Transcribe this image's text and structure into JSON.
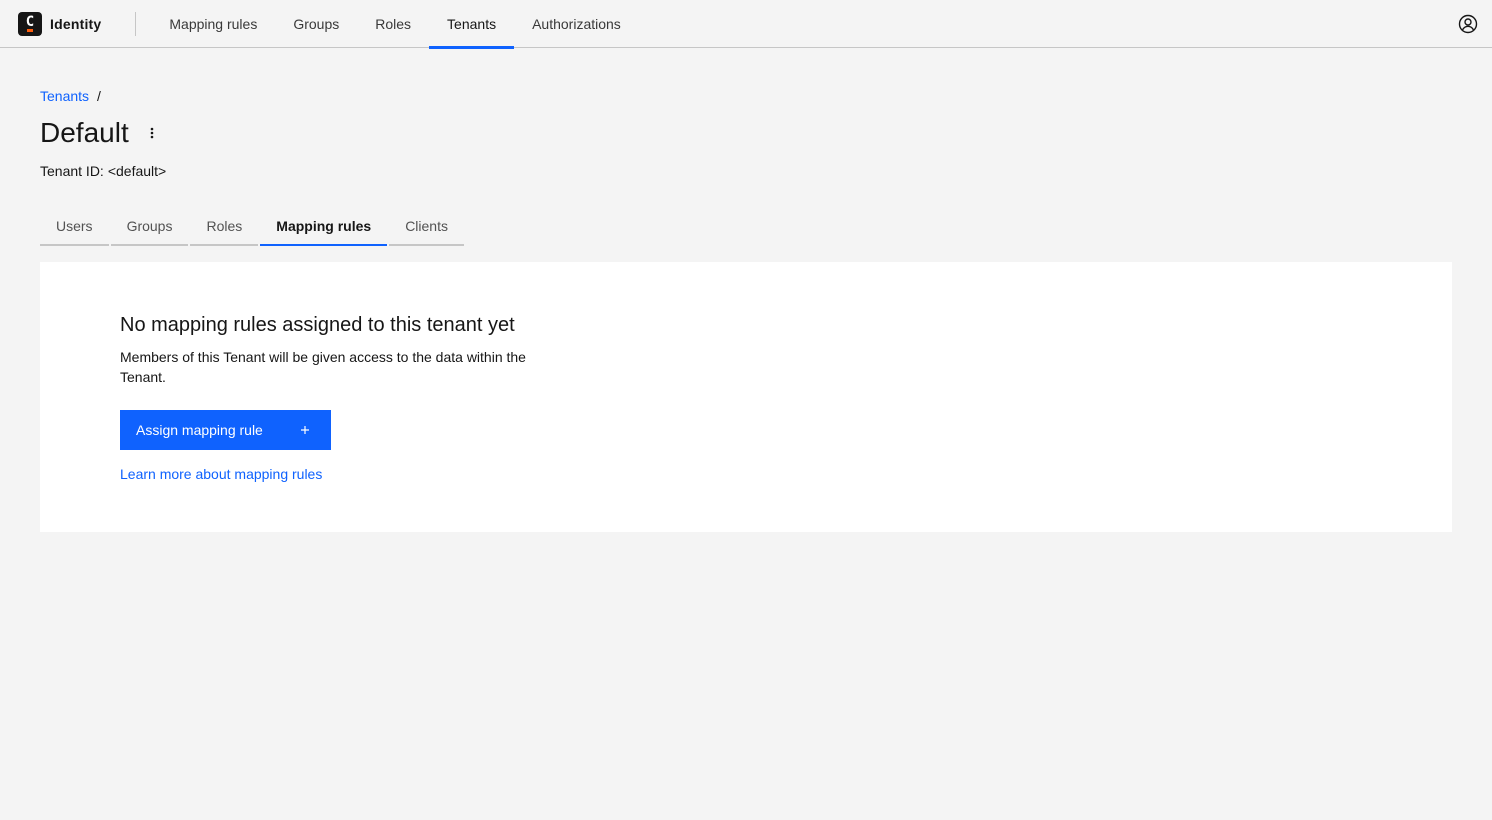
{
  "header": {
    "brand_letter": "C",
    "app_name": "Identity",
    "nav": [
      {
        "label": "Mapping rules"
      },
      {
        "label": "Groups"
      },
      {
        "label": "Roles"
      },
      {
        "label": "Tenants"
      },
      {
        "label": "Authorizations"
      }
    ],
    "active_nav": "Tenants",
    "user_icon": "user-avatar-icon"
  },
  "breadcrumb": {
    "parent": "Tenants",
    "separator": "/"
  },
  "page": {
    "title": "Default",
    "overflow_icon": "overflow-menu-vertical-icon",
    "tenant_id_label": "Tenant ID:",
    "tenant_id_value": "<default>"
  },
  "tabs": [
    {
      "label": "Users"
    },
    {
      "label": "Groups"
    },
    {
      "label": "Roles"
    },
    {
      "label": "Mapping rules"
    },
    {
      "label": "Clients"
    }
  ],
  "active_tab": "Mapping rules",
  "empty_state": {
    "title": "No mapping rules assigned to this tenant yet",
    "description": "Members of this Tenant will be given access to the data within the Tenant.",
    "button_label": "Assign mapping rule",
    "button_icon": "add-icon",
    "link_label": "Learn more about mapping rules"
  },
  "colors": {
    "accent": "#0f62fe",
    "background": "#f4f4f4",
    "logo_accent": "#fc5d0d"
  }
}
